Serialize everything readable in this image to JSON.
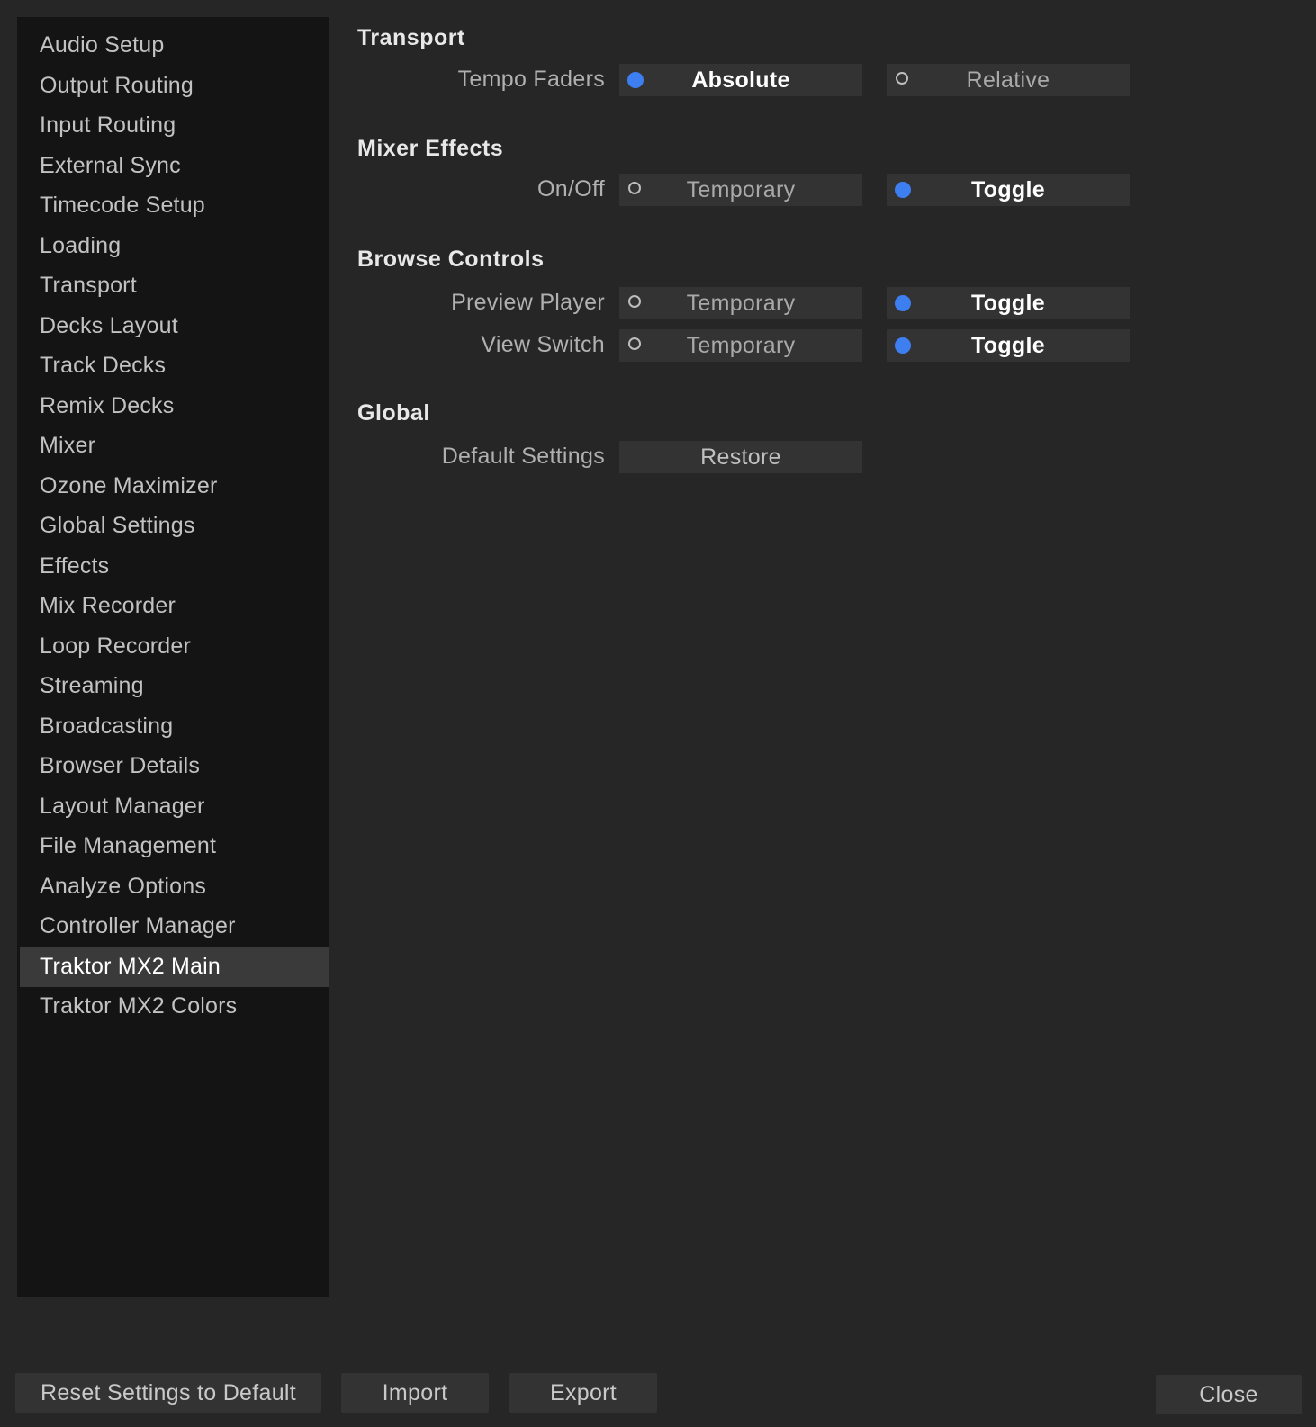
{
  "sidebar": {
    "items": [
      {
        "label": "Audio Setup"
      },
      {
        "label": "Output Routing"
      },
      {
        "label": "Input Routing"
      },
      {
        "label": "External Sync"
      },
      {
        "label": "Timecode Setup"
      },
      {
        "label": "Loading"
      },
      {
        "label": "Transport"
      },
      {
        "label": "Decks Layout"
      },
      {
        "label": "Track Decks"
      },
      {
        "label": "Remix Decks"
      },
      {
        "label": "Mixer"
      },
      {
        "label": "Ozone Maximizer"
      },
      {
        "label": "Global Settings"
      },
      {
        "label": "Effects"
      },
      {
        "label": "Mix Recorder"
      },
      {
        "label": "Loop Recorder"
      },
      {
        "label": "Streaming"
      },
      {
        "label": "Broadcasting"
      },
      {
        "label": "Browser Details"
      },
      {
        "label": "Layout Manager"
      },
      {
        "label": "File Management"
      },
      {
        "label": "Analyze Options"
      },
      {
        "label": "Controller Manager"
      },
      {
        "label": "Traktor MX2 Main"
      },
      {
        "label": "Traktor MX2 Colors"
      }
    ],
    "selected": "Traktor MX2 Main"
  },
  "main": {
    "transport": {
      "title": "Transport",
      "tempo_faders": {
        "label": "Tempo Faders",
        "option_a": "Absolute",
        "option_b": "Relative",
        "selected": "Absolute"
      }
    },
    "mixer_effects": {
      "title": "Mixer Effects",
      "on_off": {
        "label": "On/Off",
        "option_a": "Temporary",
        "option_b": "Toggle",
        "selected": "Toggle"
      }
    },
    "browse_controls": {
      "title": "Browse Controls",
      "preview_player": {
        "label": "Preview Player",
        "option_a": "Temporary",
        "option_b": "Toggle",
        "selected": "Toggle"
      },
      "view_switch": {
        "label": "View Switch",
        "option_a": "Temporary",
        "option_b": "Toggle",
        "selected": "Toggle"
      }
    },
    "global": {
      "title": "Global",
      "default_settings": {
        "label": "Default Settings",
        "button": "Restore"
      }
    }
  },
  "footer": {
    "reset_label": "Reset Settings to Default",
    "import_label": "Import",
    "export_label": "Export",
    "close_label": "Close"
  },
  "colors": {
    "background": "#262626",
    "sidebar": "#141414",
    "selected_item": "#3a3a3a",
    "accent": "#3d7ff0",
    "button": "#333333"
  }
}
